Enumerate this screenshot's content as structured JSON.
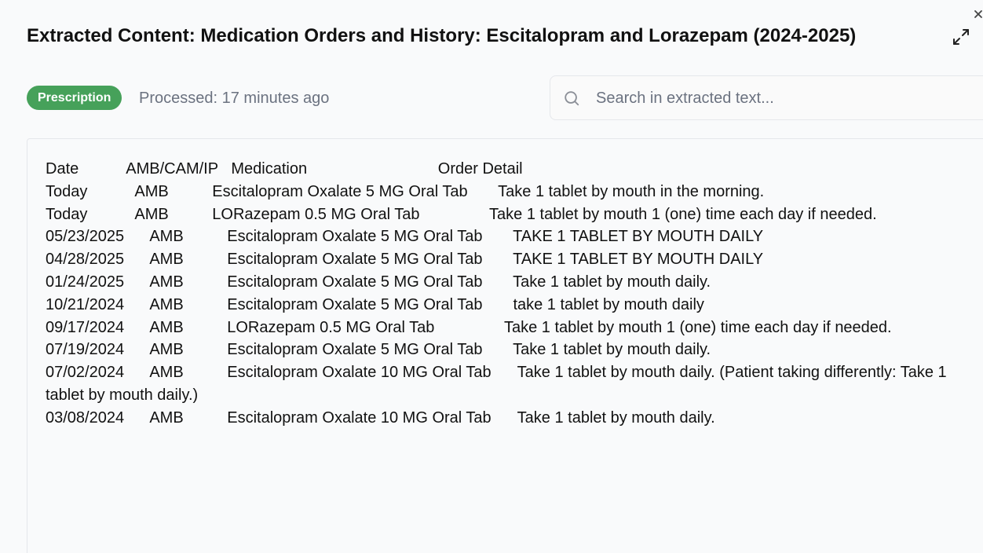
{
  "window": {
    "title": "Extracted Content: Medication Orders and History: Escitalopram and Lorazepam (2024-2025)",
    "close_icon": "close-icon",
    "expand_icon": "expand-icon"
  },
  "status": {
    "badge_label": "Prescription",
    "badge_color": "#46a15a",
    "processed_text": "Processed: 17 minutes ago"
  },
  "search": {
    "placeholder": "Search in extracted text...",
    "value": "",
    "icon": "search-icon"
  },
  "extracted": {
    "text": "Date           AMB/CAM/IP   Medication                              Order Detail\nToday           AMB          Escitalopram Oxalate 5 MG Oral Tab       Take 1 tablet by mouth in the morning.\nToday           AMB          LORazepam 0.5 MG Oral Tab                Take 1 tablet by mouth 1 (one) time each day if needed.\n05/23/2025      AMB          Escitalopram Oxalate 5 MG Oral Tab       TAKE 1 TABLET BY MOUTH DAILY\n04/28/2025      AMB          Escitalopram Oxalate 5 MG Oral Tab       TAKE 1 TABLET BY MOUTH DAILY\n01/24/2025      AMB          Escitalopram Oxalate 5 MG Oral Tab       Take 1 tablet by mouth daily.\n10/21/2024      AMB          Escitalopram Oxalate 5 MG Oral Tab       take 1 tablet by mouth daily\n09/17/2024      AMB          LORazepam 0.5 MG Oral Tab                Take 1 tablet by mouth 1 (one) time each day if needed.\n07/19/2024      AMB          Escitalopram Oxalate 5 MG Oral Tab       Take 1 tablet by mouth daily.\n07/02/2024      AMB          Escitalopram Oxalate 10 MG Oral Tab      Take 1 tablet by mouth daily. (Patient taking differently: Take 1 tablet by mouth daily.)\n03/08/2024      AMB          Escitalopram Oxalate 10 MG Oral Tab      Take 1 tablet by mouth daily."
  }
}
